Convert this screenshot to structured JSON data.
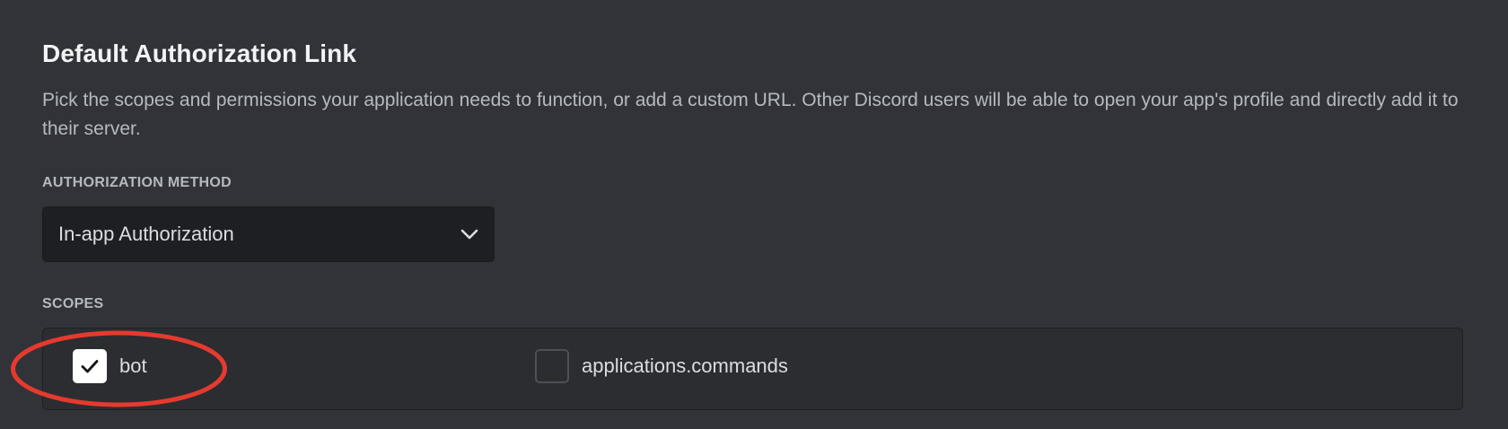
{
  "section": {
    "title": "Default Authorization Link",
    "description": "Pick the scopes and permissions your application needs to function, or add a custom URL. Other Discord users will be able to open your app's profile and directly add it to their server."
  },
  "auth_method": {
    "label": "AUTHORIZATION METHOD",
    "selected": "In-app Authorization"
  },
  "scopes": {
    "label": "SCOPES",
    "items": [
      {
        "label": "bot",
        "checked": true
      },
      {
        "label": "applications.commands",
        "checked": false
      }
    ]
  },
  "colors": {
    "background": "#313338",
    "input_bg": "#1e1f22",
    "annotation": "#e53a2e"
  },
  "icons": {
    "dropdown": "chevron-down-icon",
    "check": "checkmark-icon"
  }
}
